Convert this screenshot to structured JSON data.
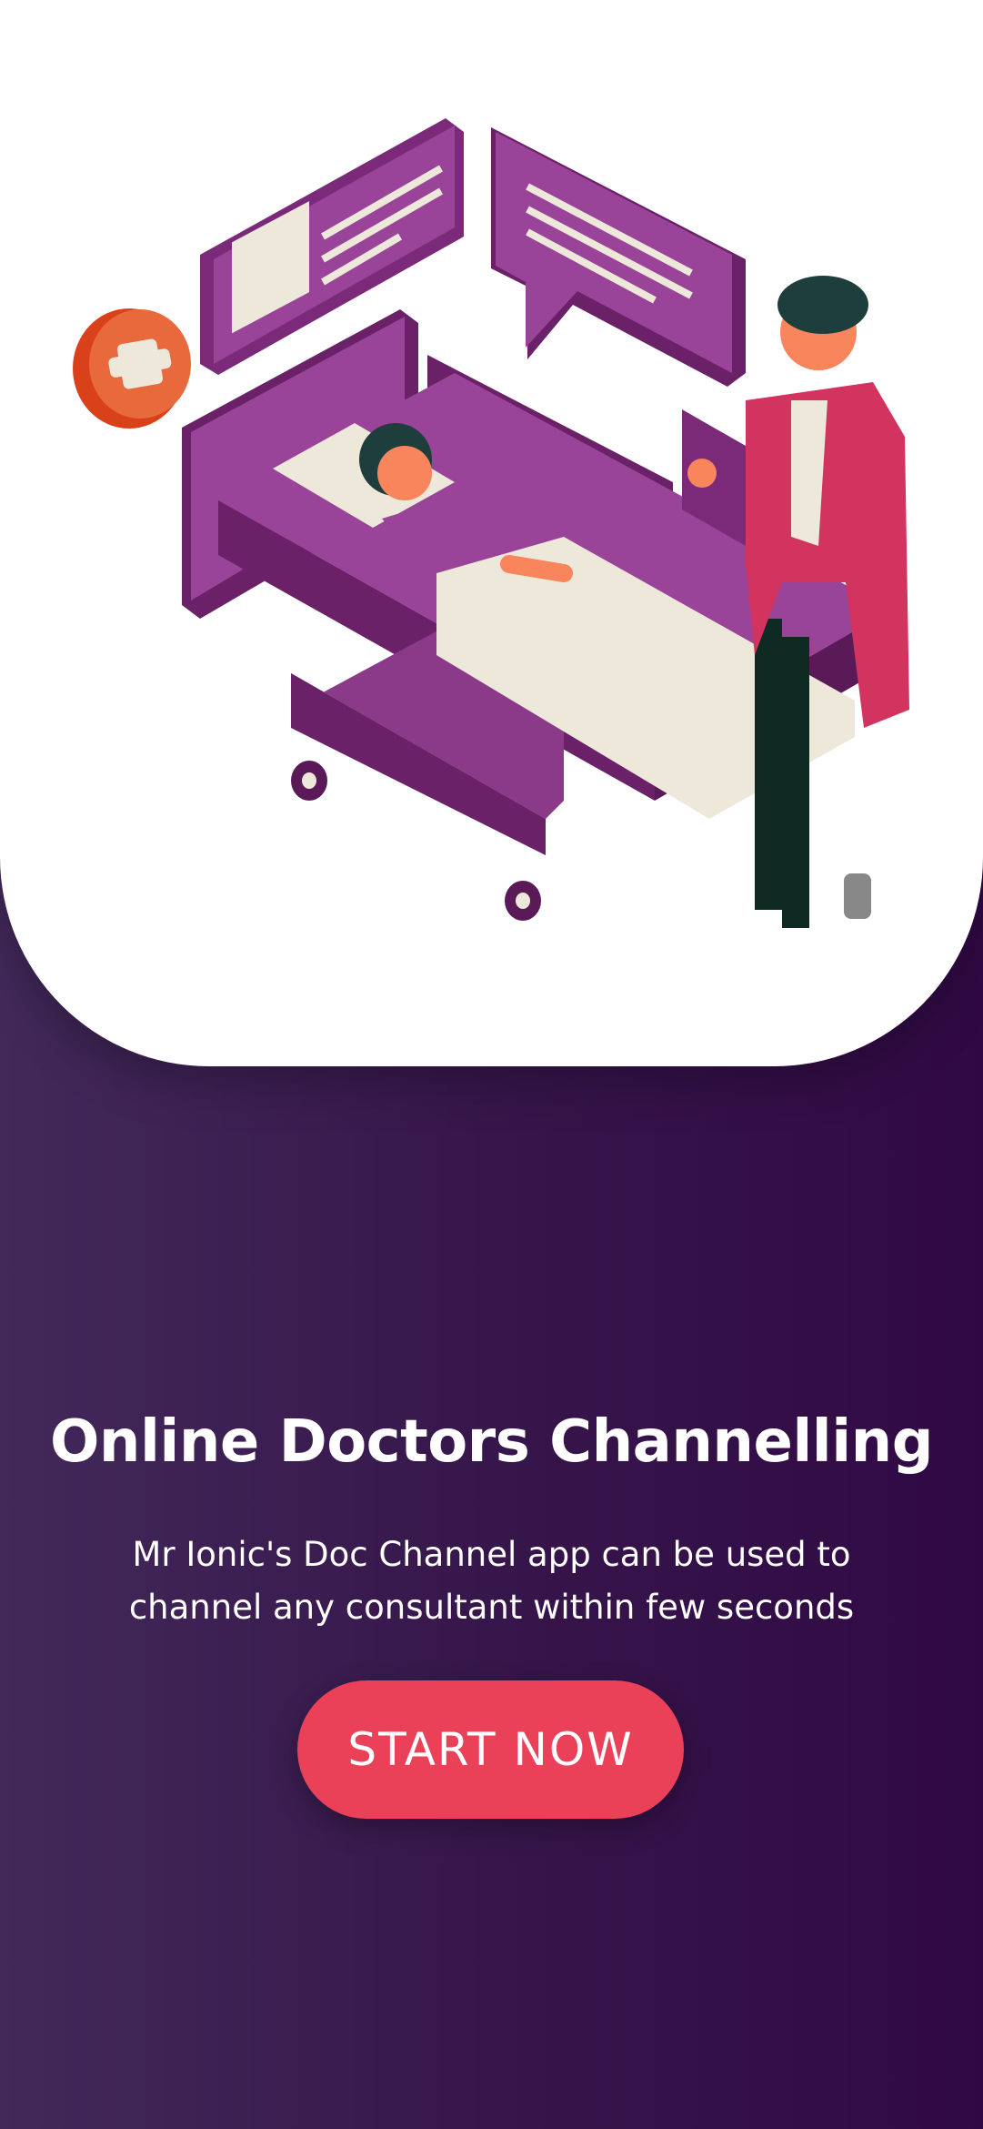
{
  "onboarding": {
    "illustration": "doctor-visiting-patient-in-hospital-bed",
    "title": "Online Doctors Channelling",
    "subtitle": "Mr Ionic's Doc Channel app can be used to channel any consultant within few seconds",
    "start_button": "START NOW"
  },
  "colors": {
    "accent": "#ea4159",
    "background_left": "#42295a",
    "background_right": "#300944",
    "card": "#ffffff"
  }
}
